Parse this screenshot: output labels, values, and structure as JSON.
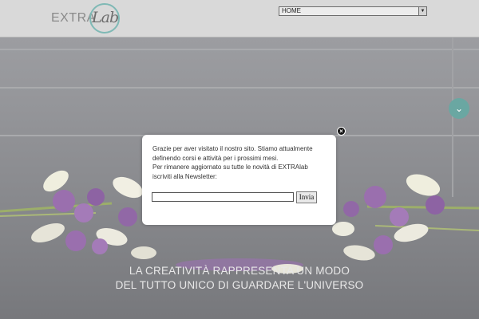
{
  "header": {
    "logo_extra": "EXTRA",
    "logo_lab": "Lab",
    "nav_select_value": "HOME"
  },
  "hero": {
    "tagline_line1": "LA CREATIVITÀ RAPPRESENTA UN MODO",
    "tagline_line2": "DEL TUTTO UNICO DI GUARDARE L'UNIVERSO"
  },
  "popup": {
    "line1": "Grazie per aver visitato il nostro sito. Stiamo attualmente",
    "line2": "definendo corsi e attività per i prossimi mesi.",
    "line3": "Per rimanere aggiornato su tutte le novità di EXTRAlab",
    "line4": "iscriviti alla Newsletter:",
    "email_value": "",
    "submit_label": "Invia"
  },
  "icons": {
    "close": "close-icon",
    "scroll_down": "chevron-down-icon",
    "select_arrow": "dropdown-arrow-icon"
  },
  "colors": {
    "accent": "#6aa7a2",
    "header_bg": "#d9d9d9"
  }
}
